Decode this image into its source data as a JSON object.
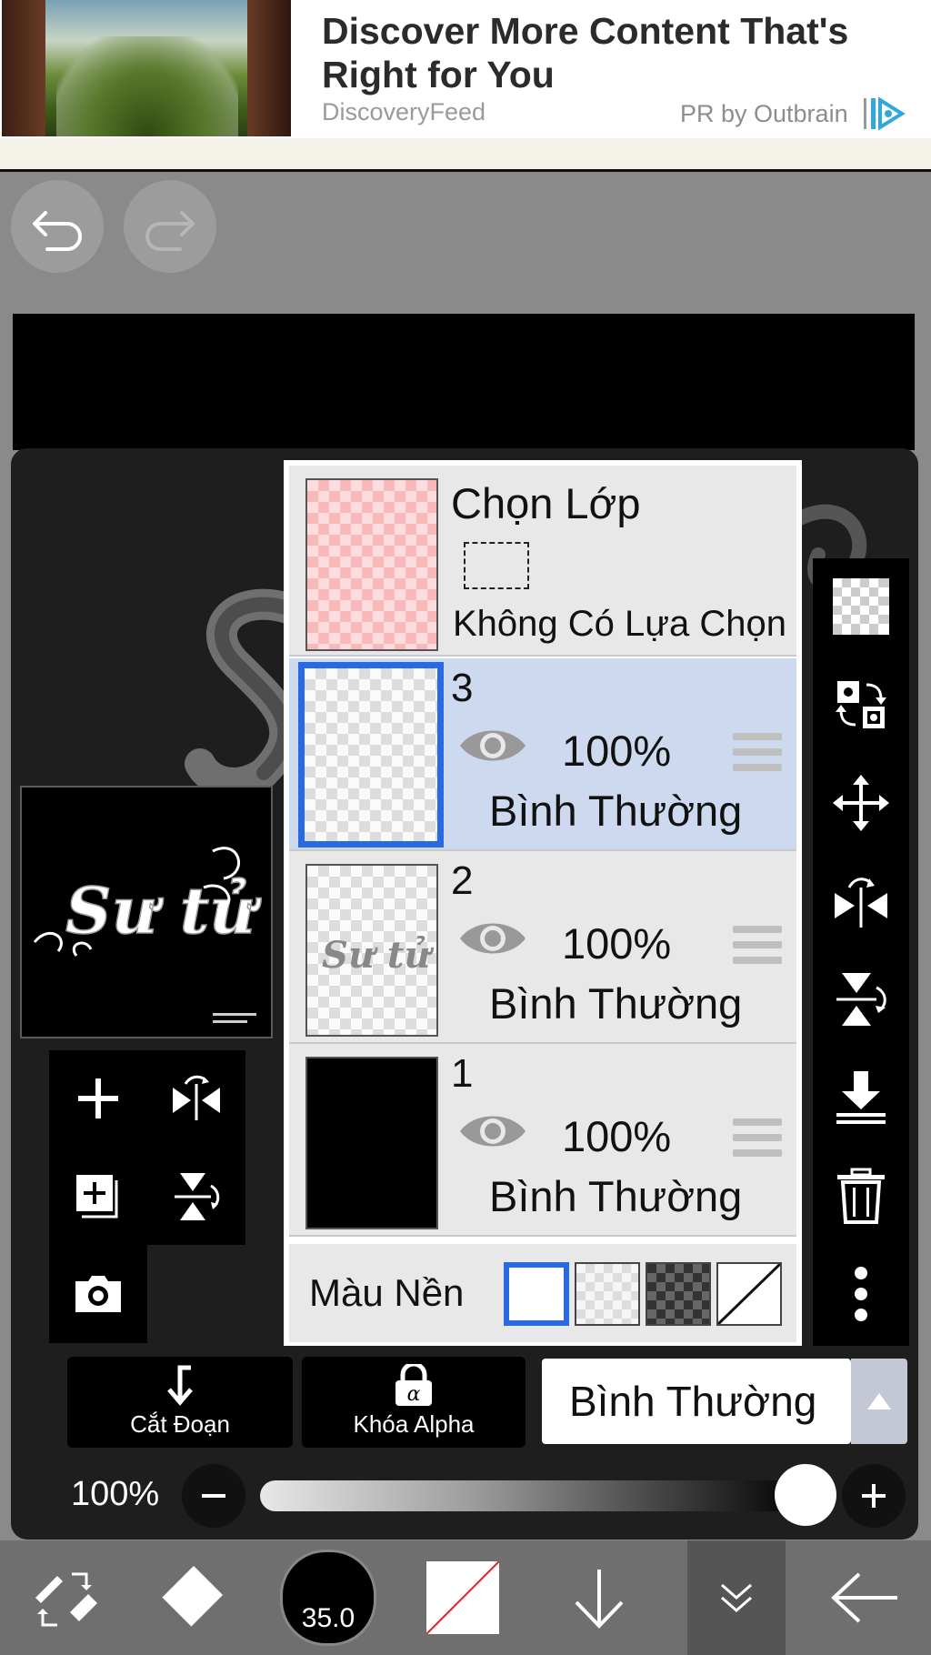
{
  "ad": {
    "title": "Discover More Content That's Right for You",
    "source": "DiscoveryFeed",
    "pr_label": "PR by Outbrain"
  },
  "layer_panel": {
    "selection": {
      "title": "Chọn Lớp",
      "status": "Không Có Lựa Chọn"
    },
    "layers": [
      {
        "number": "3",
        "opacity": "100%",
        "blend": "Bình Thường"
      },
      {
        "number": "2",
        "opacity": "100%",
        "blend": "Bình Thường"
      },
      {
        "number": "1",
        "opacity": "100%",
        "blend": "Bình Thường"
      }
    ],
    "background_label": "Màu Nền"
  },
  "controls": {
    "clipping_label": "Cắt Đoạn",
    "alpha_lock_label": "Khóa Alpha",
    "alpha_lock_icon_letter": "α",
    "blend_mode": "Bình Thường",
    "opacity_label": "100%",
    "opacity_value": 100
  },
  "toolbar": {
    "brush_size": "35.0"
  },
  "canvas": {
    "art_text": "Sư tử"
  },
  "colors": {
    "accent": "#2a6ae0",
    "active_layer_bg": "#cdd9ee",
    "panel_bg": "#e8e8e8"
  }
}
